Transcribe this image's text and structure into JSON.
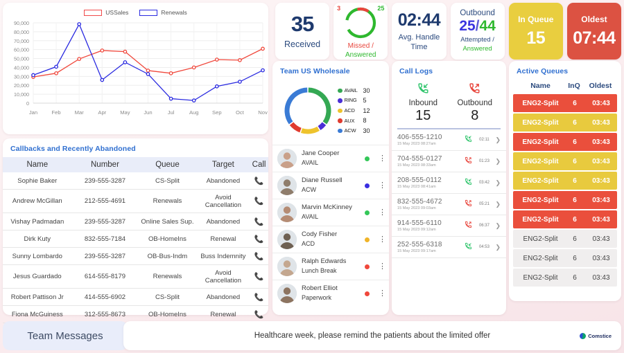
{
  "stats": [
    {
      "id": "received",
      "value": "35",
      "label": "Received"
    },
    {
      "id": "missed-answered",
      "missed": "3",
      "answered": "25",
      "label_missed": "Missed /",
      "label_answered": "Answered"
    },
    {
      "id": "avg-handle-time",
      "value": "02:44",
      "label_line1": "Avg. Handle",
      "label_line2": "Time"
    },
    {
      "id": "outbound",
      "title": "Outbound",
      "attempted": "25",
      "sep": "/",
      "answered": "44",
      "sub1": "Attempted /",
      "sub2": "Answered"
    },
    {
      "id": "in-queue",
      "label": "In Queue",
      "value": "15",
      "color": "#e9ce3f"
    },
    {
      "id": "oldest",
      "label": "Oldest",
      "value": "07:44",
      "color": "#dc5242"
    }
  ],
  "chart_data": {
    "type": "line",
    "title": "",
    "xlabel": "",
    "ylabel": "",
    "categories": [
      "Jan",
      "Feb",
      "Mar",
      "Apr",
      "May",
      "Jun",
      "Jul",
      "Aug",
      "Sep",
      "Oct",
      "Nov"
    ],
    "yticks": [
      "0",
      "10,000",
      "20,000",
      "30,000",
      "40,000",
      "50,000",
      "60,000",
      "70,000",
      "80,000",
      "90,000"
    ],
    "ylim": [
      0,
      90000
    ],
    "grid": true,
    "legend_position": "top-center",
    "series": [
      {
        "name": "USSales",
        "color": "#f0483c",
        "values": [
          29400,
          33500,
          49500,
          59000,
          57700,
          36500,
          33500,
          40000,
          48800,
          48200,
          61000
        ]
      },
      {
        "name": "Renewals",
        "color": "#2a2ae0",
        "values": [
          31400,
          40800,
          88500,
          26000,
          45800,
          32600,
          5000,
          3000,
          18800,
          24000,
          36800
        ]
      }
    ]
  },
  "callbacks": {
    "title": "Callbacks and Recently Abandoned",
    "columns": [
      "Name",
      "Number",
      "Queue",
      "Target",
      "Call"
    ],
    "rows": [
      {
        "name": "Sophie Baker",
        "number": "239-555-3287",
        "queue": "CS-Split",
        "target": "Abandoned",
        "abandoned": true
      },
      {
        "name": "Andrew McGillan",
        "number": "212-555-4691",
        "queue": "Renewals",
        "target": "Avoid Cancellation",
        "abandoned": false
      },
      {
        "name": "Vishay Padmadan",
        "number": "239-555-3287",
        "queue": "Online Sales Sup.",
        "target": "Abandoned",
        "abandoned": true
      },
      {
        "name": "Dirk Kuty",
        "number": "832-555-7184",
        "queue": "OB-HomeIns",
        "target": "Renewal",
        "abandoned": false
      },
      {
        "name": "Sunny Lombardo",
        "number": "239-555-3287",
        "queue": "OB-Bus-Indm",
        "target": "Buss Indemnity",
        "abandoned": false
      },
      {
        "name": "Jesus Guardado",
        "number": "614-555-8179",
        "queue": "Renewals",
        "target": "Avoid Cancellation",
        "abandoned": false
      },
      {
        "name": "Robert Pattison Jr",
        "number": "414-555-6902",
        "queue": "CS-Split",
        "target": "Abandoned",
        "abandoned": true
      },
      {
        "name": "Fiona McGuiness",
        "number": "312-555-8673",
        "queue": "OB-HomeIns",
        "target": "Renewal",
        "abandoned": false
      }
    ]
  },
  "team": {
    "title": "Team US Wholesale",
    "donut": {
      "type": "pie",
      "labels": [
        "AVAIL",
        "RING",
        "ACD",
        "AUX",
        "ACW"
      ],
      "values": [
        30,
        5,
        12,
        8,
        30
      ],
      "colors": [
        "#34a853",
        "#4a2fd6",
        "#eec32c",
        "#e03b2f",
        "#3a7bd5"
      ]
    },
    "agents": [
      {
        "name": "Jane Cooper",
        "status": "AVAIL",
        "dot": "#34c759"
      },
      {
        "name": "Diane Russell",
        "status": "ACW",
        "dot": "#3a2fe0"
      },
      {
        "name": "Marvin McKinney",
        "status": "AVAIL",
        "dot": "#34c759"
      },
      {
        "name": "Cody Fisher",
        "status": "ACD",
        "dot": "#f0b429"
      },
      {
        "name": "Ralph Edwards",
        "status": "Lunch Break",
        "dot": "#f0483c"
      },
      {
        "name": "Robert Elliot",
        "status": "Paperwork",
        "dot": "#f0483c"
      }
    ]
  },
  "call_logs": {
    "title": "Call Logs",
    "inbound_label": "Inbound",
    "inbound_count": "15",
    "outbound_label": "Outbound",
    "outbound_count": "8",
    "entries": [
      {
        "number": "406-555-1210",
        "datetime": "15 May 2023 08:27am",
        "direction": "inbound",
        "duration": "02:11"
      },
      {
        "number": "704-555-0127",
        "datetime": "15 May 2023 08:33am",
        "direction": "outbound",
        "duration": "01:23"
      },
      {
        "number": "208-555-0112",
        "datetime": "15 May 2023 08:41am",
        "direction": "inbound",
        "duration": "03:42"
      },
      {
        "number": "832-555-4672",
        "datetime": "15 May 2023 09:03am",
        "direction": "outbound",
        "duration": "05:21"
      },
      {
        "number": "914-555-6110",
        "datetime": "15 May 2023 09:12am",
        "direction": "outbound",
        "duration": "06:37"
      },
      {
        "number": "252-555-6318",
        "datetime": "15 May 2023 09:17am",
        "direction": "inbound",
        "duration": "04:53"
      }
    ]
  },
  "queues": {
    "title": "Active Queues",
    "columns": [
      "Name",
      "InQ",
      "Oldest"
    ],
    "rows": [
      {
        "name": "ENG2-Split",
        "inq": "6",
        "oldest": "03:43",
        "level": "red"
      },
      {
        "name": "ENG2-Split",
        "inq": "6",
        "oldest": "03:43",
        "level": "yel"
      },
      {
        "name": "ENG2-Split",
        "inq": "6",
        "oldest": "03:43",
        "level": "red"
      },
      {
        "name": "ENG2-Split",
        "inq": "6",
        "oldest": "03:43",
        "level": "yel"
      },
      {
        "name": "ENG2-Split",
        "inq": "6",
        "oldest": "03:43",
        "level": "yel"
      },
      {
        "name": "ENG2-Split",
        "inq": "6",
        "oldest": "03:43",
        "level": "red"
      },
      {
        "name": "ENG2-Split",
        "inq": "6",
        "oldest": "03:43",
        "level": "red"
      },
      {
        "name": "ENG2-Split",
        "inq": "6",
        "oldest": "03:43",
        "level": "pln"
      },
      {
        "name": "ENG2-Split",
        "inq": "6",
        "oldest": "03:43",
        "level": "pln"
      },
      {
        "name": "ENG2-Split",
        "inq": "6",
        "oldest": "03:43",
        "level": "pln"
      }
    ]
  },
  "messages": {
    "label": "Team Messages",
    "text": "Healthcare week, please remind the patients about the limited offer",
    "brand": "Comstice"
  }
}
